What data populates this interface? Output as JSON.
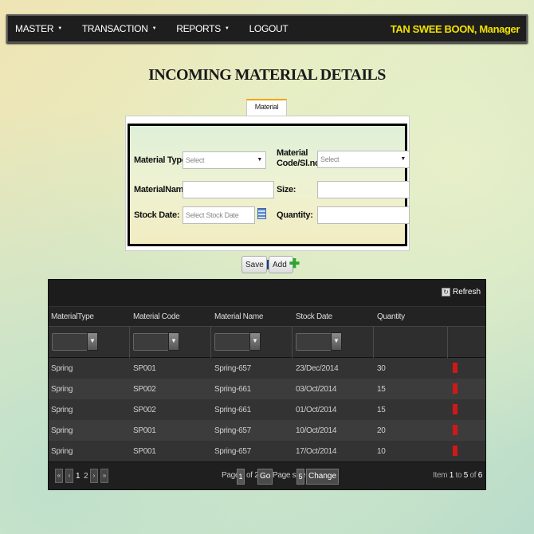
{
  "menu": [
    {
      "label": "MASTER"
    },
    {
      "label": "TRANSACTION"
    },
    {
      "label": "REPORTS"
    },
    {
      "label": "LOGOUT"
    }
  ],
  "user_label": "TAN SWEE BOON, Manager",
  "page_title": "INCOMING MATERIAL DETAILS",
  "tab_label": "Material Details",
  "form": {
    "material_type_label": "Material Type:",
    "material_type_value": "Select",
    "material_code_label": "Material Code/Sl.no:",
    "material_code_value": "Select",
    "material_name_label": "MaterialName:",
    "size_label": "Size:",
    "stock_date_label": "Stock Date:",
    "stock_date_placeholder": "Select Stock Date",
    "quantity_label": "Quantity:"
  },
  "buttons": {
    "save": "Save",
    "add": "Add"
  },
  "grid": {
    "refresh_label": "Refresh",
    "columns": [
      "MaterialType",
      "Material Code",
      "Material Name",
      "Stock Date",
      "Quantity"
    ],
    "rows": [
      [
        "Spring",
        "SP001",
        "Spring-657",
        "23/Dec/2014",
        "30"
      ],
      [
        "Spring",
        "SP002",
        "Spring-661",
        "03/Oct/2014",
        "15"
      ],
      [
        "Spring",
        "SP002",
        "Spring-661",
        "01/Oct/2014",
        "15"
      ],
      [
        "Spring",
        "SP001",
        "Spring-657",
        "10/Oct/2014",
        "20"
      ],
      [
        "Spring",
        "SP001",
        "Spring-657",
        "17/Oct/2014",
        "10"
      ]
    ],
    "pager": {
      "page_numbers": [
        "1",
        "2"
      ],
      "page_label": "Page:",
      "current_page": "1",
      "of_label": "of 2",
      "go_label": "Go",
      "page_size_label": "Page size:",
      "page_size": "5",
      "change_label": "Change",
      "item_prefix": "Item",
      "item_start": "1",
      "to_label": "to",
      "item_end": "5",
      "of_word": "of",
      "item_total": "6"
    }
  },
  "colors": {
    "user_label": "#f2e200",
    "topbar": "#1e1e1e",
    "delete_marker": "#d01818"
  }
}
